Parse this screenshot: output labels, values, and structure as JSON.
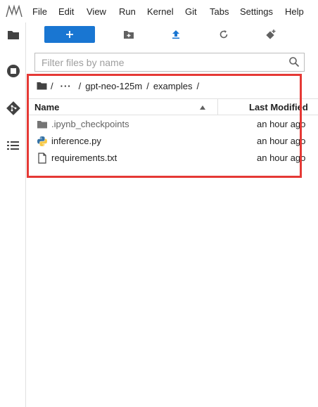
{
  "menu": {
    "items": [
      "File",
      "Edit",
      "View",
      "Run",
      "Kernel",
      "Git",
      "Tabs",
      "Settings",
      "Help"
    ]
  },
  "icons": {
    "logo": "jupyter-logo",
    "leftbar": [
      "folder-icon",
      "stop-circle-icon",
      "git-icon",
      "list-icon"
    ],
    "toolbar": [
      "plus-icon",
      "new-folder-icon",
      "upload-icon",
      "refresh-icon",
      "git-clone-icon"
    ],
    "search": "search-icon"
  },
  "colors": {
    "accent": "#1976d2",
    "highlight": "#e53935",
    "python_blue": "#3572A5",
    "python_yellow": "#f7c948"
  },
  "filter": {
    "placeholder": "Filter files by name",
    "value": ""
  },
  "breadcrumb": {
    "root": "/",
    "ellipsis": "···",
    "sep1": "/",
    "folder1": "gpt-neo-125m",
    "sep2": "/",
    "folder2": "examples",
    "sep3": "/"
  },
  "table": {
    "headers": {
      "name": "Name",
      "modified": "Last Modified"
    },
    "rows": [
      {
        "name": ".ipynb_checkpoints",
        "modified": "an hour ago",
        "icon": "folder-icon"
      },
      {
        "name": "inference.py",
        "modified": "an hour ago",
        "icon": "python-file-icon"
      },
      {
        "name": "requirements.txt",
        "modified": "an hour ago",
        "icon": "text-file-icon"
      }
    ]
  }
}
